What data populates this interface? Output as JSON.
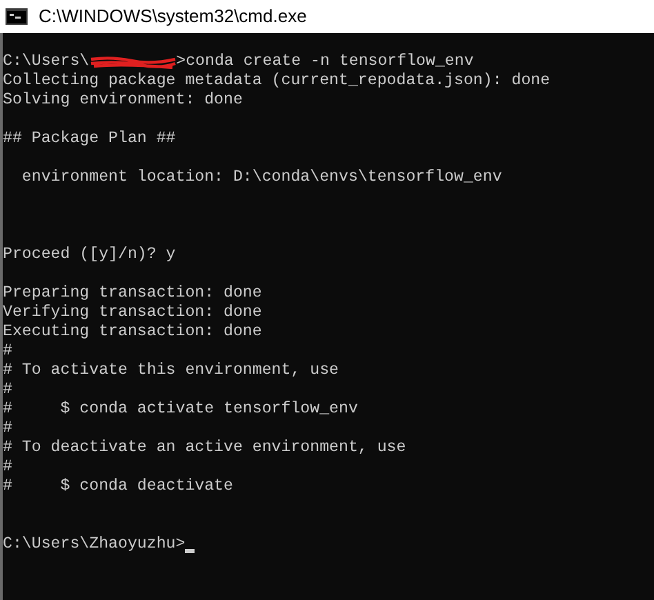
{
  "window": {
    "title": "C:\\WINDOWS\\system32\\cmd.exe"
  },
  "console": {
    "lines": [
      {
        "kind": "redacted",
        "prefix": "C:\\Users\\",
        "suffix": ">conda create -n tensorflow_env"
      },
      {
        "kind": "text",
        "text": "Collecting package metadata (current_repodata.json): done"
      },
      {
        "kind": "text",
        "text": "Solving environment: done"
      },
      {
        "kind": "blank"
      },
      {
        "kind": "text",
        "text": "## Package Plan ##"
      },
      {
        "kind": "blank"
      },
      {
        "kind": "text",
        "text": "  environment location: D:\\conda\\envs\\tensorflow_env"
      },
      {
        "kind": "blank"
      },
      {
        "kind": "blank"
      },
      {
        "kind": "blank"
      },
      {
        "kind": "text",
        "text": "Proceed ([y]/n)? y"
      },
      {
        "kind": "blank"
      },
      {
        "kind": "text",
        "text": "Preparing transaction: done"
      },
      {
        "kind": "text",
        "text": "Verifying transaction: done"
      },
      {
        "kind": "text",
        "text": "Executing transaction: done"
      },
      {
        "kind": "text",
        "text": "#"
      },
      {
        "kind": "text",
        "text": "# To activate this environment, use"
      },
      {
        "kind": "text",
        "text": "#"
      },
      {
        "kind": "text",
        "text": "#     $ conda activate tensorflow_env"
      },
      {
        "kind": "text",
        "text": "#"
      },
      {
        "kind": "text",
        "text": "# To deactivate an active environment, use"
      },
      {
        "kind": "text",
        "text": "#"
      },
      {
        "kind": "text",
        "text": "#     $ conda deactivate"
      },
      {
        "kind": "blank"
      },
      {
        "kind": "blank"
      },
      {
        "kind": "prompt",
        "text": "C:\\Users\\Zhaoyuzhu>",
        "cursor": true
      }
    ]
  }
}
